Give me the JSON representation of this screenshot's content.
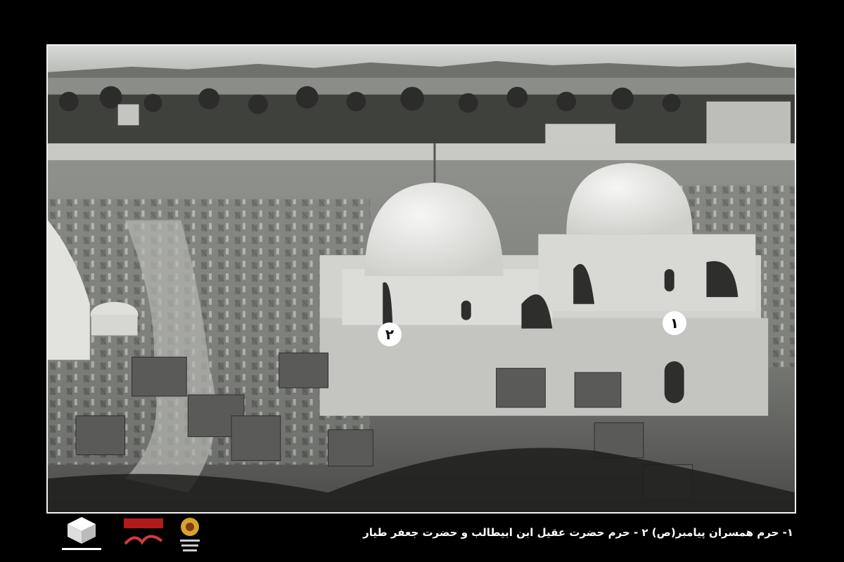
{
  "photo": {
    "description_markers": [
      {
        "label": "۱"
      },
      {
        "label": "۲"
      }
    ]
  },
  "caption": {
    "text": "۱- حرم همسران پیامبر(ص) ۲ - حرم حضرت عقیل ابن ابیطالب و حضرت جعفر طیار"
  },
  "logos": [
    {
      "name": "kaaba-logo"
    },
    {
      "name": "calligraphy-logo"
    },
    {
      "name": "sunflower-emblem-logo"
    }
  ]
}
